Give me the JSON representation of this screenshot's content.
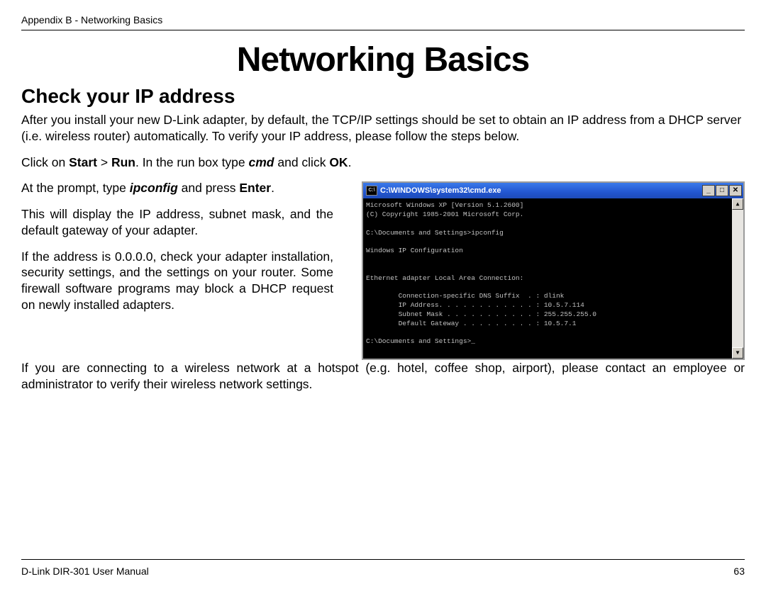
{
  "header": {
    "breadcrumb": "Appendix B - Networking Basics"
  },
  "title": "Networking Basics",
  "section_title": "Check your IP address",
  "paragraphs": {
    "intro": "After you install your new D-Link adapter, by default, the TCP/IP settings should be set to obtain an IP address from a DHCP server (i.e. wireless router) automatically. To verify your IP address, please follow the steps below.",
    "step1_pre": "Click on ",
    "step1_bold1": "Start",
    "step1_mid1": " > ",
    "step1_bold2": "Run",
    "step1_mid2": ". In the run box type ",
    "step1_cmd": "cmd",
    "step1_mid3": " and click ",
    "step1_bold3": "OK",
    "step1_end": ".",
    "step2_pre": "At the prompt, type ",
    "step2_cmd": "ipconfig",
    "step2_mid": " and press ",
    "step2_bold": "Enter",
    "step2_end": ".",
    "result": "This will display the IP address, subnet mask, and the default gateway of your adapter.",
    "troubleshoot": "If the address is 0.0.0.0, check your adapter installation, security settings, and the settings on your router. Some firewall software programs may block a DHCP request on newly installed adapters.",
    "hotspot": "If you are connecting to a wireless network at a hotspot (e.g. hotel, coffee shop, airport), please contact an employee or administrator to verify their wireless network settings."
  },
  "cmd_window": {
    "icon_text": "C:\\",
    "title": "C:\\WINDOWS\\system32\\cmd.exe",
    "min_glyph": "_",
    "max_glyph": "□",
    "close_glyph": "✕",
    "scroll_up": "▲",
    "scroll_down": "▼",
    "content": "Microsoft Windows XP [Version 5.1.2600]\n(C) Copyright 1985-2001 Microsoft Corp.\n\nC:\\Documents and Settings>ipconfig\n\nWindows IP Configuration\n\n\nEthernet adapter Local Area Connection:\n\n        Connection-specific DNS Suffix  . : dlink\n        IP Address. . . . . . . . . . . . : 10.5.7.114\n        Subnet Mask . . . . . . . . . . . : 255.255.255.0\n        Default Gateway . . . . . . . . . : 10.5.7.1\n\nC:\\Documents and Settings>_"
  },
  "footer": {
    "manual": "D-Link DIR-301 User Manual",
    "page": "63"
  }
}
